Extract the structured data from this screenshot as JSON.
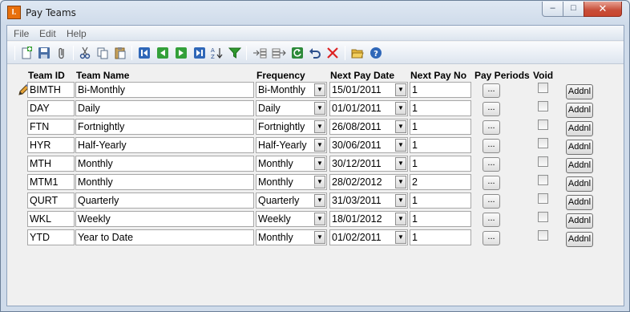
{
  "window": {
    "title": "Pay Teams",
    "app_icon_glyph": "I.",
    "close_glyph": "✕",
    "max_glyph": "□",
    "min_glyph": "–"
  },
  "menu": [
    "File",
    "Edit",
    "Help"
  ],
  "toolbar": [
    "new-icon",
    "save-icon",
    "attach-icon",
    "cut-icon",
    "copy-icon",
    "paste-icon",
    "first-record-icon",
    "prev-record-icon",
    "next-record-icon",
    "last-record-icon",
    "sort-icon",
    "filter-icon",
    "insert-row-icon",
    "append-row-icon",
    "refresh-icon",
    "undo-icon",
    "delete-icon",
    "open-folder-icon",
    "help-icon"
  ],
  "columns": {
    "team_id": "Team ID",
    "team_name": "Team Name",
    "frequency": "Frequency",
    "next_pay_date": "Next Pay Date",
    "next_pay_no": "Next Pay No",
    "pay_periods": "Pay Periods",
    "void": "Void"
  },
  "buttons": {
    "periods": "...",
    "addnl": "Addnl"
  },
  "rows": [
    {
      "id": "BIMTH",
      "name": "Bi-Monthly",
      "frequency": "Bi-Monthly",
      "date": "15/01/2011",
      "no": "1",
      "void": false
    },
    {
      "id": "DAY",
      "name": "Daily",
      "frequency": "Daily",
      "date": "01/01/2011",
      "no": "1",
      "void": false
    },
    {
      "id": "FTN",
      "name": "Fortnightly",
      "frequency": "Fortnightly",
      "date": "26/08/2011",
      "no": "1",
      "void": false
    },
    {
      "id": "HYR",
      "name": "Half-Yearly",
      "frequency": "Half-Yearly",
      "date": "30/06/2011",
      "no": "1",
      "void": false
    },
    {
      "id": "MTH",
      "name": "Monthly",
      "frequency": "Monthly",
      "date": "30/12/2011",
      "no": "1",
      "void": false
    },
    {
      "id": "MTM1",
      "name": "Monthly",
      "frequency": "Monthly",
      "date": "28/02/2012",
      "no": "2",
      "void": false
    },
    {
      "id": "QURT",
      "name": "Quarterly",
      "frequency": "Quarterly",
      "date": "31/03/2011",
      "no": "1",
      "void": false
    },
    {
      "id": "WKL",
      "name": "Weekly",
      "frequency": "Weekly",
      "date": "18/01/2012",
      "no": "1",
      "void": false
    },
    {
      "id": "YTD",
      "name": "Year to Date",
      "frequency": "Monthly",
      "date": "01/02/2011",
      "no": "1",
      "void": false
    }
  ]
}
